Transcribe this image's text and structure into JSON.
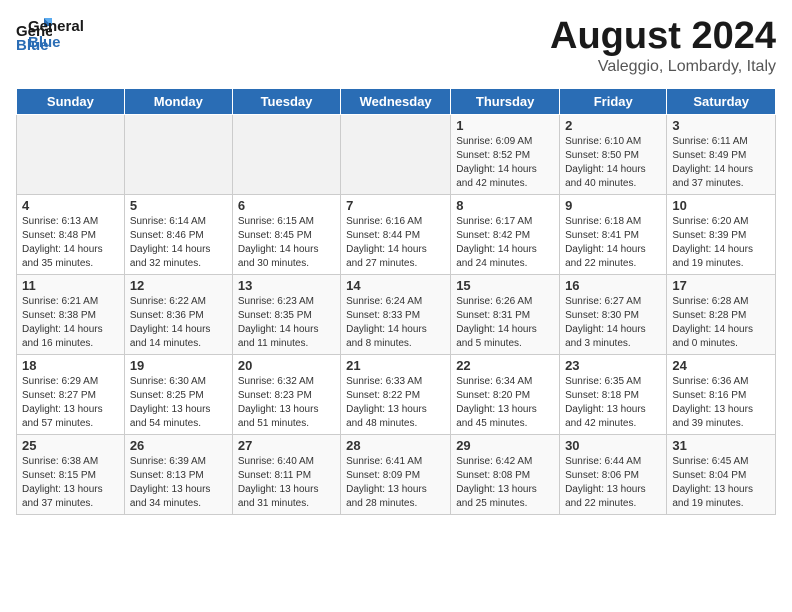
{
  "header": {
    "logo_line1": "General",
    "logo_line2": "Blue",
    "title": "August 2024",
    "subtitle": "Valeggio, Lombardy, Italy"
  },
  "weekdays": [
    "Sunday",
    "Monday",
    "Tuesday",
    "Wednesday",
    "Thursday",
    "Friday",
    "Saturday"
  ],
  "weeks": [
    [
      {
        "day": "",
        "info": ""
      },
      {
        "day": "",
        "info": ""
      },
      {
        "day": "",
        "info": ""
      },
      {
        "day": "",
        "info": ""
      },
      {
        "day": "1",
        "info": "Sunrise: 6:09 AM\nSunset: 8:52 PM\nDaylight: 14 hours\nand 42 minutes."
      },
      {
        "day": "2",
        "info": "Sunrise: 6:10 AM\nSunset: 8:50 PM\nDaylight: 14 hours\nand 40 minutes."
      },
      {
        "day": "3",
        "info": "Sunrise: 6:11 AM\nSunset: 8:49 PM\nDaylight: 14 hours\nand 37 minutes."
      }
    ],
    [
      {
        "day": "4",
        "info": "Sunrise: 6:13 AM\nSunset: 8:48 PM\nDaylight: 14 hours\nand 35 minutes."
      },
      {
        "day": "5",
        "info": "Sunrise: 6:14 AM\nSunset: 8:46 PM\nDaylight: 14 hours\nand 32 minutes."
      },
      {
        "day": "6",
        "info": "Sunrise: 6:15 AM\nSunset: 8:45 PM\nDaylight: 14 hours\nand 30 minutes."
      },
      {
        "day": "7",
        "info": "Sunrise: 6:16 AM\nSunset: 8:44 PM\nDaylight: 14 hours\nand 27 minutes."
      },
      {
        "day": "8",
        "info": "Sunrise: 6:17 AM\nSunset: 8:42 PM\nDaylight: 14 hours\nand 24 minutes."
      },
      {
        "day": "9",
        "info": "Sunrise: 6:18 AM\nSunset: 8:41 PM\nDaylight: 14 hours\nand 22 minutes."
      },
      {
        "day": "10",
        "info": "Sunrise: 6:20 AM\nSunset: 8:39 PM\nDaylight: 14 hours\nand 19 minutes."
      }
    ],
    [
      {
        "day": "11",
        "info": "Sunrise: 6:21 AM\nSunset: 8:38 PM\nDaylight: 14 hours\nand 16 minutes."
      },
      {
        "day": "12",
        "info": "Sunrise: 6:22 AM\nSunset: 8:36 PM\nDaylight: 14 hours\nand 14 minutes."
      },
      {
        "day": "13",
        "info": "Sunrise: 6:23 AM\nSunset: 8:35 PM\nDaylight: 14 hours\nand 11 minutes."
      },
      {
        "day": "14",
        "info": "Sunrise: 6:24 AM\nSunset: 8:33 PM\nDaylight: 14 hours\nand 8 minutes."
      },
      {
        "day": "15",
        "info": "Sunrise: 6:26 AM\nSunset: 8:31 PM\nDaylight: 14 hours\nand 5 minutes."
      },
      {
        "day": "16",
        "info": "Sunrise: 6:27 AM\nSunset: 8:30 PM\nDaylight: 14 hours\nand 3 minutes."
      },
      {
        "day": "17",
        "info": "Sunrise: 6:28 AM\nSunset: 8:28 PM\nDaylight: 14 hours\nand 0 minutes."
      }
    ],
    [
      {
        "day": "18",
        "info": "Sunrise: 6:29 AM\nSunset: 8:27 PM\nDaylight: 13 hours\nand 57 minutes."
      },
      {
        "day": "19",
        "info": "Sunrise: 6:30 AM\nSunset: 8:25 PM\nDaylight: 13 hours\nand 54 minutes."
      },
      {
        "day": "20",
        "info": "Sunrise: 6:32 AM\nSunset: 8:23 PM\nDaylight: 13 hours\nand 51 minutes."
      },
      {
        "day": "21",
        "info": "Sunrise: 6:33 AM\nSunset: 8:22 PM\nDaylight: 13 hours\nand 48 minutes."
      },
      {
        "day": "22",
        "info": "Sunrise: 6:34 AM\nSunset: 8:20 PM\nDaylight: 13 hours\nand 45 minutes."
      },
      {
        "day": "23",
        "info": "Sunrise: 6:35 AM\nSunset: 8:18 PM\nDaylight: 13 hours\nand 42 minutes."
      },
      {
        "day": "24",
        "info": "Sunrise: 6:36 AM\nSunset: 8:16 PM\nDaylight: 13 hours\nand 39 minutes."
      }
    ],
    [
      {
        "day": "25",
        "info": "Sunrise: 6:38 AM\nSunset: 8:15 PM\nDaylight: 13 hours\nand 37 minutes."
      },
      {
        "day": "26",
        "info": "Sunrise: 6:39 AM\nSunset: 8:13 PM\nDaylight: 13 hours\nand 34 minutes."
      },
      {
        "day": "27",
        "info": "Sunrise: 6:40 AM\nSunset: 8:11 PM\nDaylight: 13 hours\nand 31 minutes."
      },
      {
        "day": "28",
        "info": "Sunrise: 6:41 AM\nSunset: 8:09 PM\nDaylight: 13 hours\nand 28 minutes."
      },
      {
        "day": "29",
        "info": "Sunrise: 6:42 AM\nSunset: 8:08 PM\nDaylight: 13 hours\nand 25 minutes."
      },
      {
        "day": "30",
        "info": "Sunrise: 6:44 AM\nSunset: 8:06 PM\nDaylight: 13 hours\nand 22 minutes."
      },
      {
        "day": "31",
        "info": "Sunrise: 6:45 AM\nSunset: 8:04 PM\nDaylight: 13 hours\nand 19 minutes."
      }
    ]
  ]
}
